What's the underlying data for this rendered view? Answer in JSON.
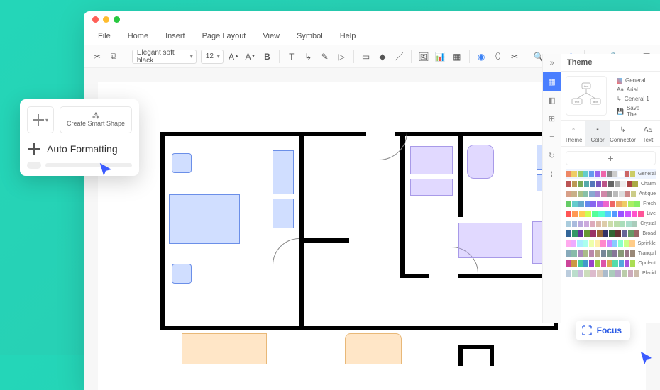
{
  "menu": {
    "file": "File",
    "home": "Home",
    "insert": "Insert",
    "layout": "Page Layout",
    "view": "View",
    "symbol": "Symbol",
    "help": "Help"
  },
  "toolbar": {
    "font": "Elegant soft black",
    "size": "12"
  },
  "popup": {
    "create_smart_shape": "Create Smart Shape",
    "auto_formatting": "Auto Formatting"
  },
  "theme_panel": {
    "title": "Theme",
    "quick": [
      "General",
      "Arial",
      "General 1",
      "Save The..."
    ],
    "tabs": [
      "Theme",
      "Color",
      "Connector",
      "Text"
    ],
    "palettes": [
      "General",
      "Charm",
      "Antique",
      "Fresh",
      "Live",
      "Crystal",
      "Broad",
      "Sprinkle",
      "Tranquil",
      "Opulent",
      "Placid"
    ]
  },
  "focus": {
    "label": "Focus"
  },
  "palette_colors": [
    [
      "#e86",
      "#ec6",
      "#9c6",
      "#6cc",
      "#69e",
      "#96e",
      "#e6a",
      "#888",
      "#ccc",
      "#fff",
      "#c66",
      "#cc6"
    ],
    [
      "#b55",
      "#b95",
      "#7a5",
      "#5aa",
      "#57b",
      "#75b",
      "#b58",
      "#666",
      "#aaa",
      "#eee",
      "#a44",
      "#aa4"
    ],
    [
      "#d8a088",
      "#c8b088",
      "#a8c088",
      "#88c0a8",
      "#88a8d0",
      "#a888d0",
      "#d088a8",
      "#999",
      "#bbb",
      "#ddd",
      "#c88",
      "#cc8"
    ],
    [
      "#6c6",
      "#6cc",
      "#6ac",
      "#68e",
      "#86e",
      "#a6e",
      "#e6c",
      "#e66",
      "#ea6",
      "#ec6",
      "#ae6",
      "#8e6"
    ],
    [
      "#f55",
      "#f95",
      "#fc5",
      "#cf5",
      "#5f9",
      "#5fc",
      "#5cf",
      "#59f",
      "#95f",
      "#c5f",
      "#f5c",
      "#f59"
    ],
    [
      "#acd",
      "#abd",
      "#bad",
      "#cad",
      "#dab",
      "#dba",
      "#dca",
      "#cda",
      "#bda",
      "#adb",
      "#adc",
      "#acb"
    ],
    [
      "#369",
      "#396",
      "#639",
      "#693",
      "#936",
      "#963",
      "#336",
      "#363",
      "#633",
      "#669",
      "#696",
      "#966"
    ],
    [
      "#fae",
      "#eaf",
      "#aef",
      "#afe",
      "#efa",
      "#fea",
      "#f8c",
      "#c8f",
      "#8cf",
      "#8fc",
      "#cf8",
      "#fc8"
    ],
    [
      "#8ab",
      "#8ba",
      "#a8b",
      "#ab8",
      "#b8a",
      "#ba8",
      "#789",
      "#798",
      "#879",
      "#897",
      "#978",
      "#987"
    ],
    [
      "#c49",
      "#c94",
      "#4c9",
      "#49c",
      "#94c",
      "#9c4",
      "#d5a",
      "#da5",
      "#5da",
      "#5ad",
      "#a5d",
      "#ad5"
    ],
    [
      "#bcd",
      "#bdc",
      "#cbd",
      "#cdb",
      "#dbc",
      "#dcb",
      "#abc",
      "#acb",
      "#bac",
      "#bca",
      "#cab",
      "#cba"
    ]
  ]
}
